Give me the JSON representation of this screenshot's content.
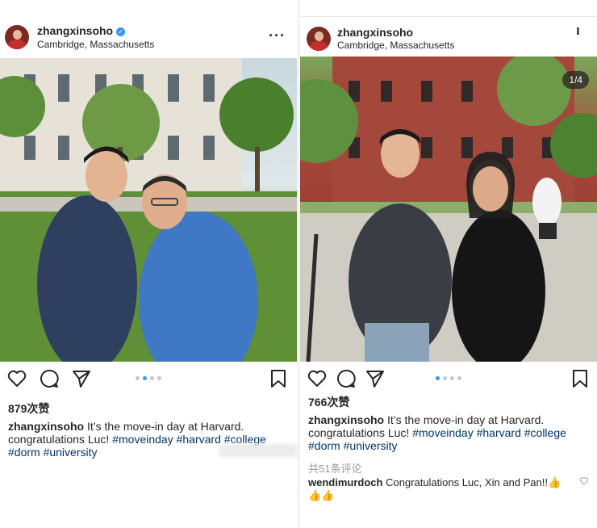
{
  "left_post": {
    "username": "zhangxinsoho",
    "location": "Cambridge, Massachusetts",
    "likes": "879次赞",
    "caption_user": "zhangxinsoho",
    "caption_text": "It’s the move-in day at Harvard.",
    "caption_line2": "congratulations Luc!",
    "hashtags": [
      "#moveinday",
      "#harvard",
      "#college",
      "#dorm",
      "#university"
    ],
    "icons": [
      "heart-icon",
      "comment-icon",
      "share-icon",
      "bookmark-icon",
      "more-icon",
      "verified-icon"
    ]
  },
  "right_post": {
    "username": "zhangxinsoho",
    "location": "Cambridge, Massachusetts",
    "image_counter": "1/4",
    "likes": "766次赞",
    "caption_user": "zhangxinsoho",
    "caption_text": "It’s the move-in day at Harvard.",
    "caption_line2": "congratulations Luc!",
    "hashtags": [
      "#moveinday",
      "#harvard",
      "#college",
      "#dorm",
      "#university"
    ],
    "comments_link": "共51条评论",
    "comment_user": "wendimurdoch",
    "comment_text": "Congratulations Luc, Xin and Pan!!👍",
    "comment_emoji": "👍👍",
    "icons": [
      "heart-icon",
      "comment-icon",
      "share-icon",
      "bookmark-icon",
      "more-icon"
    ]
  },
  "colors": {
    "hashtag": "#003569",
    "verified": "#3897f0",
    "carousel_active": "#3897f0"
  }
}
